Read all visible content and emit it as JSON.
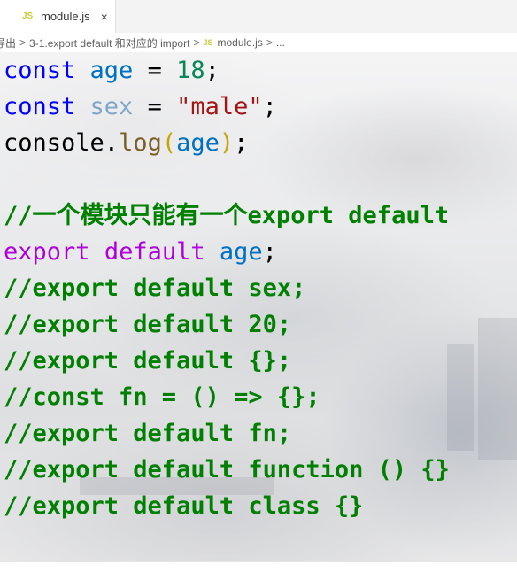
{
  "tab": {
    "icon_text": "JS",
    "label": "module.js",
    "close_glyph": "×"
  },
  "breadcrumb": {
    "items": [
      "导出",
      "3-1.export default 和对应的 import",
      "module.js",
      "..."
    ],
    "separator": ">",
    "file_icon_text": "JS"
  },
  "editor": {
    "lines": [
      {
        "tokens": [
          {
            "t": "const",
            "c": "kw"
          },
          {
            "t": " "
          },
          {
            "t": "age",
            "c": "var"
          },
          {
            "t": " = "
          },
          {
            "t": "18",
            "c": "num"
          },
          {
            "t": ";"
          }
        ]
      },
      {
        "tokens": [
          {
            "t": "const",
            "c": "kw"
          },
          {
            "t": " "
          },
          {
            "t": "sex",
            "c": "var-dim"
          },
          {
            "t": " = "
          },
          {
            "t": "\"male\"",
            "c": "str"
          },
          {
            "t": ";"
          }
        ]
      },
      {
        "tokens": [
          {
            "t": "console",
            "c": "op"
          },
          {
            "t": "."
          },
          {
            "t": "log",
            "c": "fn"
          },
          {
            "t": "(",
            "c": "paren"
          },
          {
            "t": "age",
            "c": "var"
          },
          {
            "t": ")",
            "c": "paren"
          },
          {
            "t": ";"
          }
        ]
      },
      {
        "tokens": []
      },
      {
        "tokens": [
          {
            "t": "//一个模块只能有一个export default",
            "c": "comment"
          }
        ]
      },
      {
        "tokens": [
          {
            "t": "export",
            "c": "export-kw"
          },
          {
            "t": " "
          },
          {
            "t": "default",
            "c": "export-kw"
          },
          {
            "t": " "
          },
          {
            "t": "age",
            "c": "var"
          },
          {
            "t": ";"
          }
        ]
      },
      {
        "tokens": [
          {
            "t": "//export default sex;",
            "c": "comment"
          }
        ]
      },
      {
        "tokens": [
          {
            "t": "//export default 20;",
            "c": "comment"
          }
        ]
      },
      {
        "tokens": [
          {
            "t": "//export default {};",
            "c": "comment"
          }
        ]
      },
      {
        "tokens": [
          {
            "t": "//const fn = () => {};",
            "c": "comment"
          }
        ]
      },
      {
        "tokens": [
          {
            "t": "//export default fn;",
            "c": "comment"
          }
        ]
      },
      {
        "tokens": [
          {
            "t": "//export default function () {}",
            "c": "comment"
          }
        ]
      },
      {
        "tokens": [
          {
            "t": "//export default class {}",
            "c": "comment"
          }
        ]
      }
    ]
  }
}
